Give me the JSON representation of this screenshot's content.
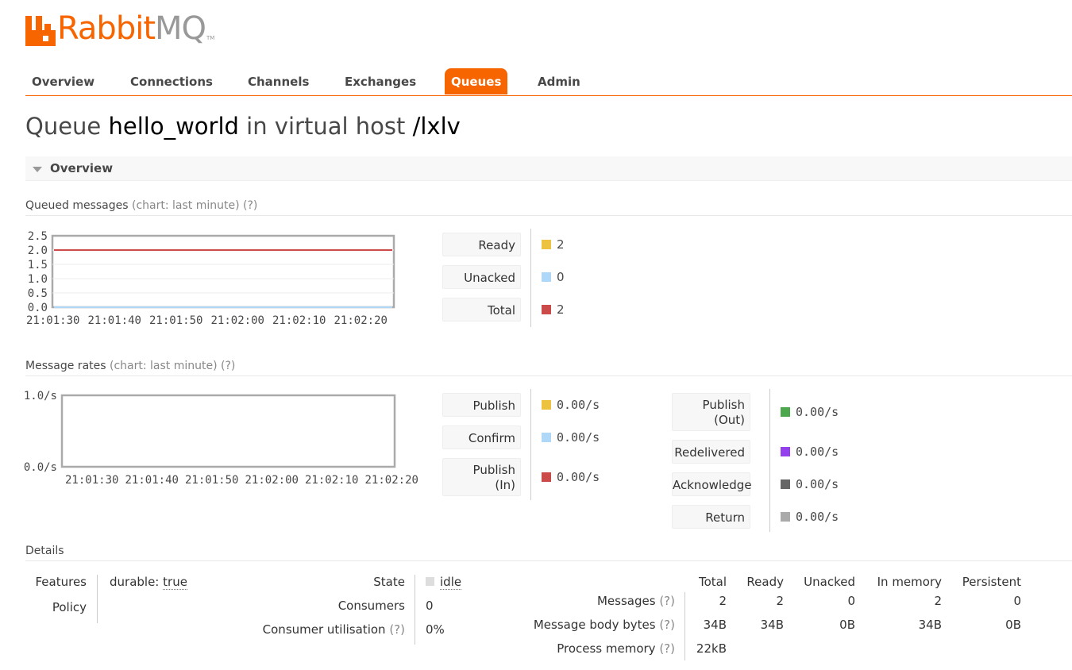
{
  "brand": {
    "name": "Rabbit",
    "name_suffix": "MQ",
    "trademark": "TM",
    "color": "#f66500"
  },
  "tabs": [
    {
      "label": "Overview",
      "active": false
    },
    {
      "label": "Connections",
      "active": false
    },
    {
      "label": "Channels",
      "active": false
    },
    {
      "label": "Exchanges",
      "active": false
    },
    {
      "label": "Queues",
      "active": true
    },
    {
      "label": "Admin",
      "active": false
    }
  ],
  "title": {
    "prefix": "Queue",
    "queue": "hello_world",
    "middle": "in virtual host",
    "vhost": "/lxlv"
  },
  "section": {
    "label": "Overview",
    "icon": "collapse-triangle-icon"
  },
  "queued": {
    "heading": "Queued messages",
    "chart_note": "(chart: last minute)",
    "help": "(?)",
    "legend": [
      {
        "label": "Ready",
        "value": "2",
        "color": "#edc240"
      },
      {
        "label": "Unacked",
        "value": "0",
        "color": "#afd8f8"
      },
      {
        "label": "Total",
        "value": "2",
        "color": "#cb4b4b"
      }
    ]
  },
  "rates": {
    "heading": "Message rates",
    "chart_note": "(chart: last minute)",
    "help": "(?)",
    "legend_left": [
      {
        "label": "Publish",
        "value": "0.00/s",
        "color": "#edc240"
      },
      {
        "label": "Confirm",
        "value": "0.00/s",
        "color": "#afd8f8"
      },
      {
        "label": "Publish",
        "label2": "(In)",
        "value": "0.00/s",
        "color": "#cb4b4b"
      }
    ],
    "legend_right": [
      {
        "label": "Publish",
        "label2": "(Out)",
        "value": "0.00/s",
        "color": "#4da74d"
      },
      {
        "label": "Redelivered",
        "value": "0.00/s",
        "color": "#9440ed"
      },
      {
        "label": "Acknowledge",
        "value": "0.00/s",
        "color": "#666666"
      },
      {
        "label": "Return",
        "value": "0.00/s",
        "color": "#aaaaaa"
      }
    ]
  },
  "chart_data": [
    {
      "type": "line",
      "x": [
        "21:01:30",
        "21:01:40",
        "21:01:50",
        "21:02:00",
        "21:02:10",
        "21:02:20"
      ],
      "ylim": [
        0,
        2.5
      ],
      "yticks": [
        "2.5",
        "2.0",
        "1.5",
        "1.0",
        "0.5",
        "0.0"
      ],
      "grid": true,
      "series": [
        {
          "name": "Ready",
          "values": [
            2,
            2,
            2,
            2,
            2,
            2
          ],
          "color": "#edc240"
        },
        {
          "name": "Unacked",
          "values": [
            0,
            0,
            0,
            0,
            0,
            0
          ],
          "color": "#afd8f8"
        },
        {
          "name": "Total",
          "values": [
            2,
            2,
            2,
            2,
            2,
            2
          ],
          "color": "#cb4b4b"
        }
      ]
    },
    {
      "type": "line",
      "x": [
        "21:01:30",
        "21:01:40",
        "21:01:50",
        "21:02:00",
        "21:02:10",
        "21:02:20"
      ],
      "ylim": [
        0,
        1
      ],
      "yticks": [
        "1.0/s",
        "0.0/s"
      ],
      "grid": false,
      "series": []
    }
  ],
  "details": {
    "heading": "Details",
    "features_label": "Features",
    "features_key": "durable:",
    "features_val": "true",
    "policy_label": "Policy",
    "state_label": "State",
    "state_val": "idle",
    "consumers_label": "Consumers",
    "consumers_val": "0",
    "util_label": "Consumer utilisation",
    "util_help": "(?)",
    "util_val": "0%",
    "columns": [
      "Total",
      "Ready",
      "Unacked",
      "In memory",
      "Persistent"
    ],
    "rows": [
      {
        "label": "Messages",
        "help": "(?)",
        "values": [
          "2",
          "2",
          "0",
          "2",
          "0"
        ]
      },
      {
        "label": "Message body bytes",
        "help": "(?)",
        "values": [
          "34B",
          "34B",
          "0B",
          "34B",
          "0B"
        ]
      },
      {
        "label": "Process memory",
        "help": "(?)",
        "values": [
          "22kB",
          "",
          "",
          "",
          ""
        ]
      }
    ]
  }
}
